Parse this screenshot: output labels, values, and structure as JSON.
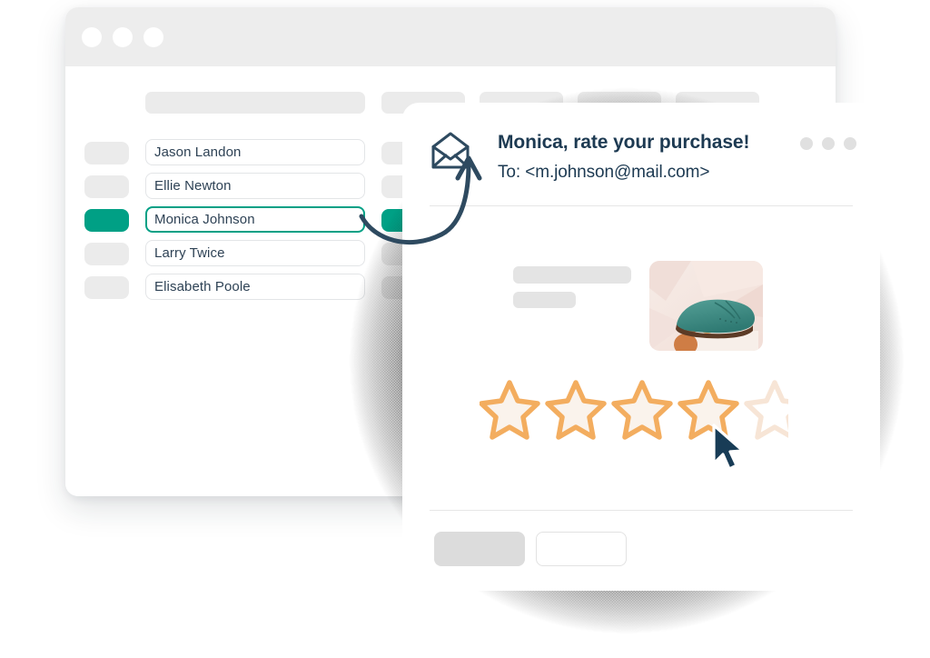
{
  "window": {
    "traffic_lights": [
      "close-dot",
      "minimize-dot",
      "maximize-dot"
    ],
    "header_blocks": 4,
    "contacts": [
      {
        "name": "Jason Landon",
        "selected": false
      },
      {
        "name": "Ellie Newton",
        "selected": false
      },
      {
        "name": "Monica Johnson",
        "selected": true
      },
      {
        "name": "Larry Twice",
        "selected": false
      },
      {
        "name": "Elisabeth Poole",
        "selected": false
      }
    ]
  },
  "email_card": {
    "icon": "open-envelope-icon",
    "title": "Monica, rate your purchase!",
    "recipient": "To: <m.johnson@mail.com>",
    "window_dots": 3,
    "product": {
      "image_alt": "teal suede derby shoe on peach backdrop",
      "placeholder_lines": 2
    },
    "rating": {
      "max": 5,
      "value": 4,
      "star_stroke": "#f3ad5f",
      "star_fill": "#faf3ec",
      "empty_stroke": "#f7e5d6",
      "empty_fill": "#ffffff"
    },
    "cursor": "mouse-pointer-icon",
    "actions": [
      {
        "name": "primary-action",
        "style": "filled"
      },
      {
        "name": "secondary-action",
        "style": "outline"
      }
    ]
  },
  "annotation": {
    "arrow": "curved-arrow-from-contact-to-email"
  },
  "colors": {
    "accent_teal": "#00a085",
    "text_navy": "#1d3a52",
    "name_text": "#2e4255",
    "placeholder_gray": "#ebebeb",
    "chrome_gray": "#ededed",
    "shadow_black": "#0a0a0a"
  }
}
